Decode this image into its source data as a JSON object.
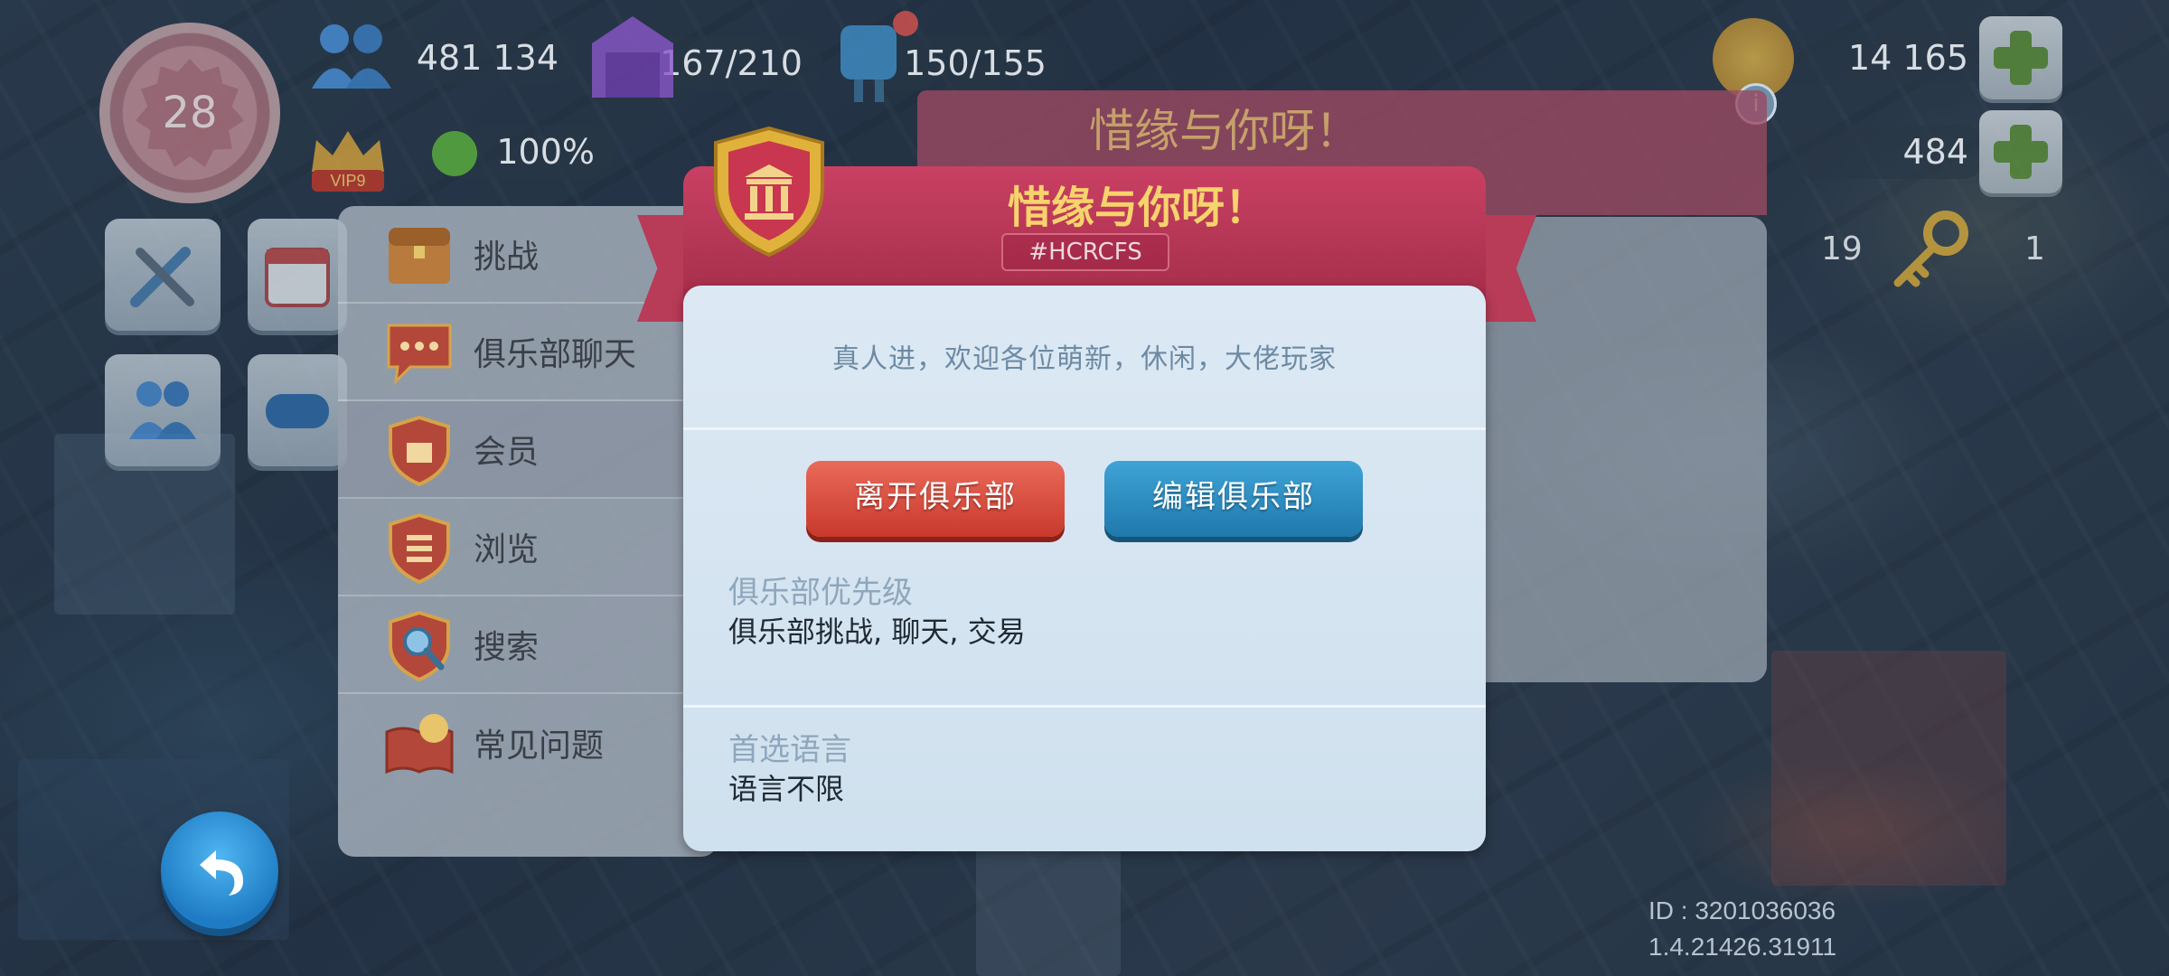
{
  "hud": {
    "level": "28",
    "vip": "VIP9",
    "population": "481 134",
    "storage": "167/210",
    "water": "150/155",
    "happiness": "100%",
    "simoleons": "14 165",
    "simcash": "484",
    "bg_stat_a": "19",
    "keys": "1"
  },
  "menu": {
    "items": [
      {
        "label": "挑战",
        "icon": "treasure-chest-icon"
      },
      {
        "label": "俱乐部聊天",
        "icon": "chat-bubble-icon"
      },
      {
        "label": "会员",
        "icon": "club-shield-icon"
      },
      {
        "label": "浏览",
        "icon": "browse-shield-icon"
      },
      {
        "label": "搜索",
        "icon": "magnifier-icon"
      },
      {
        "label": "常见问题",
        "icon": "faq-book-icon"
      }
    ]
  },
  "club_bg": {
    "title": "惜缘与你呀！"
  },
  "dialog": {
    "title": "惜缘与你呀！",
    "tag": "#HCRCFS",
    "description": "真人进，欢迎各位萌新，休闲，大佬玩家",
    "leave_label": "离开俱乐部",
    "edit_label": "编辑俱乐部",
    "priority_label": "俱乐部优先级",
    "priority_value": "俱乐部挑战, 聊天, 交易",
    "language_label": "首选语言",
    "language_value": "语言不限"
  },
  "footer": {
    "id": "ID : 3201036036",
    "version": "1.4.21426.31911"
  },
  "colors": {
    "ribbon": "#b83b58",
    "title_gold": "#f7d36c",
    "leave_red": "#c8392c",
    "edit_blue": "#1f79ad",
    "dialog_bg": "#dce9f4"
  }
}
